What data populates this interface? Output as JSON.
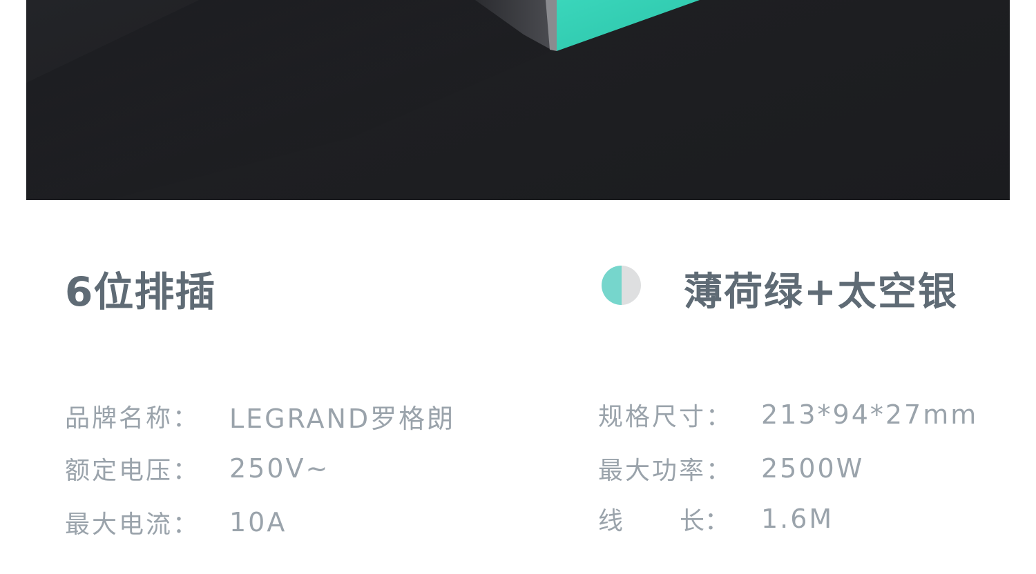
{
  "product": {
    "title": "6位排插",
    "color_name": "薄荷绿+太空银",
    "swatch_colors": [
      "#76d6cc",
      "#dedfe0"
    ]
  },
  "specs_left": [
    {
      "label": "品牌名称：",
      "value": "LEGRAND罗格朗"
    },
    {
      "label": "额定电压：",
      "value": "250V~"
    },
    {
      "label": "最大电流：",
      "value": "10A"
    }
  ],
  "specs_right": [
    {
      "label": "规格尺寸：",
      "value": "213*94*27mm"
    },
    {
      "label": "最大功率：",
      "value": "2500W"
    },
    {
      "label_parts": [
        "线",
        "长："
      ],
      "value": "1.6M"
    }
  ],
  "colors": {
    "hero_bg": "#1e1f22",
    "mint": "#35d0b5",
    "text_dark": "#5f6b75",
    "text_light": "#9aa3ab"
  }
}
